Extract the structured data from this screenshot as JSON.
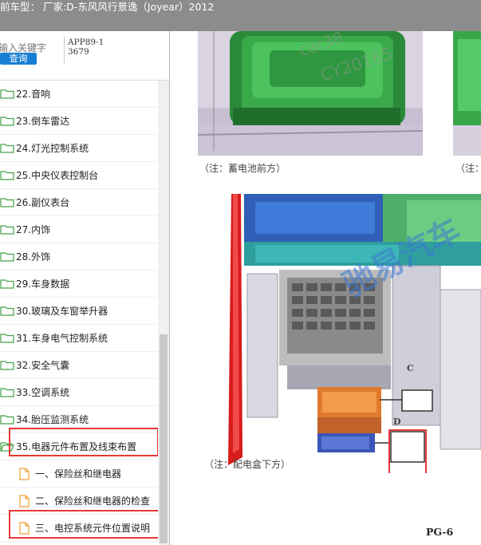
{
  "window": {
    "title": "前车型： 厂家:D-东风风行景逸（Joyear）2012"
  },
  "search": {
    "placeholder": "输入关键字",
    "button_label": "查询",
    "app_code": "APP89-13679"
  },
  "tree": {
    "items": [
      {
        "label": "22.音响",
        "type": "folder"
      },
      {
        "label": "23.倒车雷达",
        "type": "folder"
      },
      {
        "label": "24.灯光控制系统",
        "type": "folder"
      },
      {
        "label": "25.中央仪表控制台",
        "type": "folder"
      },
      {
        "label": "26.副仪表台",
        "type": "folder"
      },
      {
        "label": "27.内饰",
        "type": "folder"
      },
      {
        "label": "28.外饰",
        "type": "folder"
      },
      {
        "label": "29.车身数据",
        "type": "folder"
      },
      {
        "label": "30.玻璃及车窗举升器",
        "type": "folder"
      },
      {
        "label": "31.车身电气控制系统",
        "type": "folder"
      },
      {
        "label": "32.安全气囊",
        "type": "folder"
      },
      {
        "label": "33.空调系统",
        "type": "folder"
      },
      {
        "label": "34.胎压监测系统",
        "type": "folder"
      },
      {
        "label": "35.电器元件布置及线束布置",
        "type": "folder-open"
      },
      {
        "label": "一、保险丝和继电器",
        "type": "doc"
      },
      {
        "label": "二、保险丝和继电器的检查",
        "type": "doc"
      },
      {
        "label": "三、电控系统元件位置说明",
        "type": "doc"
      }
    ]
  },
  "document": {
    "caption_top_left": "（注：蓄电池前方）",
    "caption_top_right": "（注：",
    "caption_bottom": "（注：配电盒下方）",
    "label_c": "C",
    "label_d": "D",
    "page_label": "PG-6",
    "watermark_1": "car38",
    "watermark_2": "CY20165",
    "watermark_3": "驰易汽车"
  },
  "colors": {
    "titlebar": "#8c8c8c",
    "accent": "#1a7fd4",
    "highlight": "#e53935",
    "folder": "#4caf50"
  }
}
